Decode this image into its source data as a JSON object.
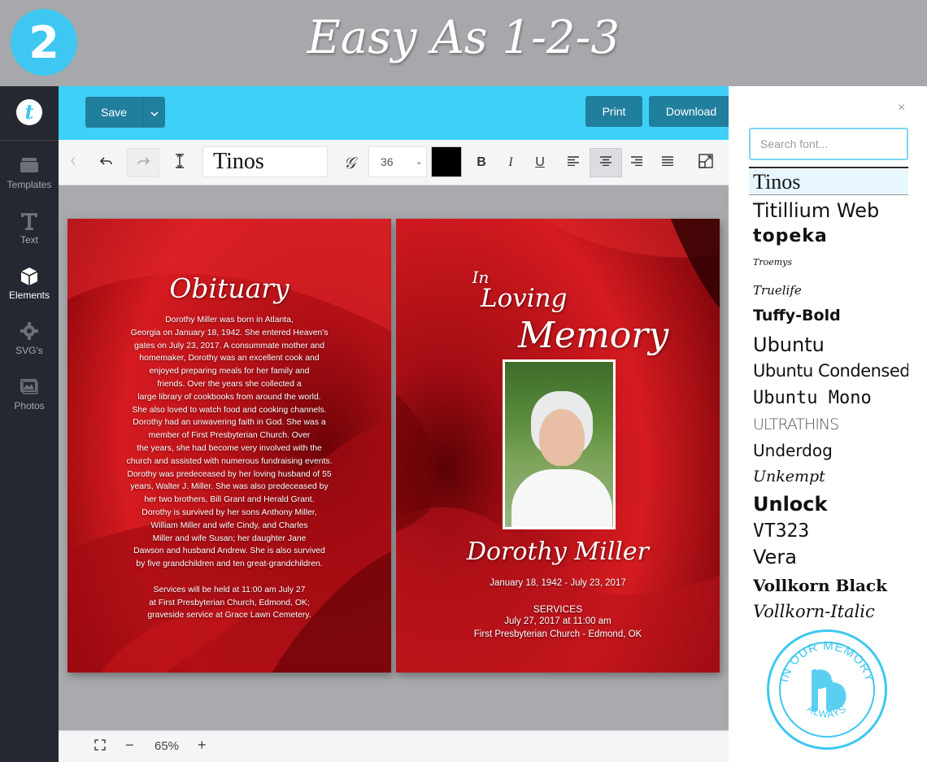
{
  "banner": {
    "step": "2",
    "title": "Easy As 1-2-3"
  },
  "rail": {
    "logo": "t",
    "items": [
      {
        "label": "Templates",
        "icon": "templates-icon"
      },
      {
        "label": "Text",
        "icon": "text-icon"
      },
      {
        "label": "Elements",
        "icon": "elements-icon",
        "active": true
      },
      {
        "label": "SVG's",
        "icon": "gear-icon"
      },
      {
        "label": "Photos",
        "icon": "photos-icon"
      }
    ]
  },
  "topbar": {
    "save_label": "Save",
    "print_label": "Print",
    "download_label": "Download"
  },
  "format": {
    "font_name": "Tinos",
    "font_size": "36",
    "text_color": "#000000"
  },
  "zoom": {
    "level": "65%",
    "minus": "−",
    "plus": "+"
  },
  "left_page": {
    "heading": "Obituary",
    "body": "Dorothy Miller was born in Atlanta,\nGeorgia on January 18, 1942. She entered Heaven's\ngates on July 23, 2017. A consummate mother and\nhomemaker, Dorothy was an excellent cook and\nenjoyed preparing meals for her family and\nfriends. Over the years she collected a\nlarge library of cookbooks from around the world.\nShe also loved to watch food and cooking channels.\nDorothy had an unwavering faith in God. She was a\nmember of First Presbyterian Church. Over\nthe years, she had become very involved with the\nchurch and assisted with numerous fundraising events.\nDorothy was predeceased by her loving husband of 55\nyears, Walter J. Miller. She was also predeceased by\nher two brothers, Bill Grant and Herald Grant.\nDorothy is survived by her sons Anthony Miller,\nWilliam Miller and wife Cindy, and Charles\nMiller and wife Susan; her daughter Jane\nDawson and husband Andrew. She is also survived\nby five grandchildren and ten great-grandchildren.\n\nServices will be held at 11:00 am July 27\nat First Presbyterian Church, Edmond, OK;\ngraveside service at Grace Lawn Cemetery."
  },
  "right_page": {
    "in_text": "In",
    "loving_text": "Loving",
    "memory_text": "Memory",
    "name": "Dorothy Miller",
    "dates": "January 18, 1942 - July 23, 2017",
    "services_heading": "SERVICES",
    "services_date": "July 27, 2017 at 11:00 am",
    "services_place": "First Presbyterian Church - Edmond, OK"
  },
  "font_panel": {
    "close": "×",
    "search_placeholder": "Search font...",
    "fonts": [
      "Tinos",
      "Titillium Web",
      "topeka",
      "Troemys",
      "Truelife",
      "Tuffy-Bold",
      "Ubuntu",
      "Ubuntu Condensed",
      "Ubuntu Mono",
      "ULTRATHINS",
      "Underdog",
      "Unkempt",
      "Unlock",
      "VT323",
      "Vera",
      "Vollkorn Black",
      "Vollkorn-Italic"
    ],
    "badge": {
      "top": "IN OUR MEMORY",
      "bottom": "ALWAYS"
    }
  },
  "colors": {
    "accent": "#3fd0f8",
    "button": "#217f9e",
    "rail": "#252830",
    "rose": "#c8121a"
  }
}
